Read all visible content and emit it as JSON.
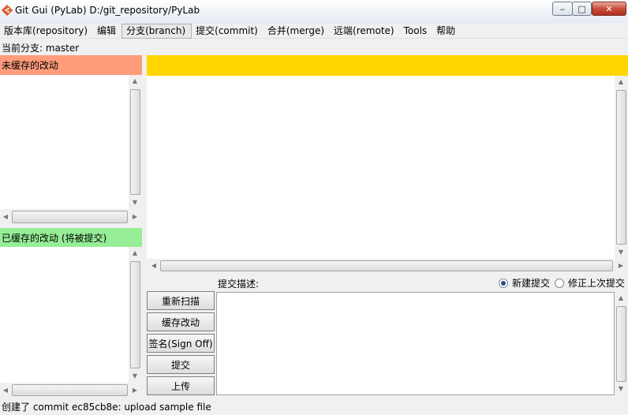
{
  "window": {
    "title": "Git Gui (PyLab) D:/git_repository/PyLab",
    "min_glyph": "‒",
    "max_glyph": "□",
    "close_glyph": "✕"
  },
  "menu": [
    {
      "label": "版本库(repository)"
    },
    {
      "label": "编辑"
    },
    {
      "label": "分支(branch)"
    },
    {
      "label": "提交(commit)"
    },
    {
      "label": "合并(merge)"
    },
    {
      "label": "远端(remote)"
    },
    {
      "label": "Tools"
    },
    {
      "label": "帮助"
    }
  ],
  "branch_line": "当前分支: master",
  "unstaged_header": "未缓存的改动",
  "staged_header": "已缓存的改动 (将被提交)",
  "commit": {
    "label": "提交描述:",
    "radio_new": "新建提交",
    "radio_amend": "修正上次提交",
    "buttons": {
      "rescan": "重新扫描",
      "stage": "缓存改动",
      "signoff": "签名(Sign Off)",
      "commit": "提交",
      "push": "上传"
    }
  },
  "status": "创建了 commit ec85cb8e: upload sample file",
  "colors": {
    "unstaged": "#ff9c7b",
    "staged": "#96ee96",
    "diff_header": "#ffd600"
  },
  "icons": {
    "app": "git-logo-icon"
  }
}
